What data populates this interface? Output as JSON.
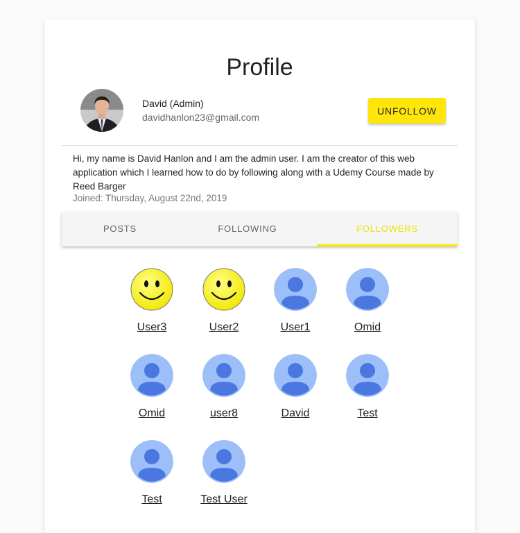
{
  "page": {
    "title": "Profile"
  },
  "profile": {
    "name": "David (Admin)",
    "email": "davidhanlon23@gmail.com",
    "follow_button_label": "UNFOLLOW",
    "bio": "Hi, my name is David Hanlon and I am the admin user. I am the creator of this web application which I learned how to do by following along with a Udemy Course made by Reed Barger",
    "joined": "Joined: Thursday, August 22nd, 2019"
  },
  "tabs": [
    {
      "label": "POSTS",
      "active": false
    },
    {
      "label": "FOLLOWING",
      "active": false
    },
    {
      "label": "FOLLOWERS",
      "active": true
    }
  ],
  "followers": [
    {
      "name": "User3",
      "avatar": "smiley-icon"
    },
    {
      "name": "User2",
      "avatar": "smiley-icon"
    },
    {
      "name": "User1",
      "avatar": "default-user-icon"
    },
    {
      "name": "Omid",
      "avatar": "default-user-icon"
    },
    {
      "name": "Omid",
      "avatar": "default-user-icon"
    },
    {
      "name": "user8",
      "avatar": "default-user-icon"
    },
    {
      "name": "David",
      "avatar": "default-user-icon"
    },
    {
      "name": "Test",
      "avatar": "default-user-icon"
    },
    {
      "name": "Test",
      "avatar": "default-user-icon"
    },
    {
      "name": "Test User",
      "avatar": "default-user-icon"
    }
  ],
  "colors": {
    "accent_yellow": "#ffe50a",
    "avatar_bg": "#9dbff9",
    "avatar_fg": "#4a77e0",
    "smiley_yellow": "#ffff00"
  }
}
